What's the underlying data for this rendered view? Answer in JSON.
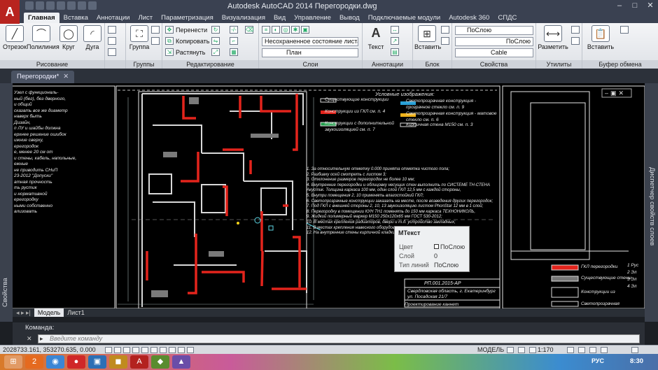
{
  "window": {
    "title": "Autodesk AutoCAD 2014    Перегородки.dwg",
    "logo": "A"
  },
  "ribbon_tabs": [
    "Главная",
    "Вставка",
    "Аннотации",
    "Лист",
    "Параметризация",
    "Визуализация",
    "Вид",
    "Управление",
    "Вывод",
    "Подключаемые модули",
    "Autodesk 360",
    "СПДС"
  ],
  "ribbon": {
    "draw": {
      "title": "Рисование",
      "tools": [
        "Отрезок",
        "Полилиния",
        "Круг",
        "Дуга"
      ]
    },
    "groups": {
      "title": "Группы",
      "tool": "Группа"
    },
    "modify": {
      "title": "Редактирование",
      "move": "Перенести",
      "copy": "Копировать",
      "stretch": "Растянуть"
    },
    "layers": {
      "title": "Слои",
      "state_combo": "Несохраненное состояние листа",
      "layer_combo": "План"
    },
    "annotation": {
      "title": "Аннотации",
      "text": "Текст"
    },
    "block": {
      "title": "Блок",
      "insert": "Вставить"
    },
    "properties": {
      "title": "Свойства",
      "color": "ПоСлою",
      "linetype": "ПоСлою",
      "lineweight": "Cable"
    },
    "utilities": {
      "title": "Утилиты",
      "measure": "Разметить"
    },
    "clipboard": {
      "title": "Буфер обмена",
      "paste": "Вставить"
    }
  },
  "doc_tab": {
    "label": "Перегородки*"
  },
  "palettes": {
    "left": "Свойства",
    "right": "Диспетчер свойств слоев"
  },
  "drawing_text": {
    "legend_title": "Условные изображения:",
    "legend": [
      "Существующие конструкции",
      "Конструкции из ГКЛ см. п. 4",
      "Конструкции с дополнительной звукоизоляцией см. п. 7",
      "Светопрозрачная конструкция - прозрачное стекло см. п. 9",
      "Светопрозрачная конструкция - матовое стекло см. п. 6",
      "Кирпичная стена М150 см. п. 3"
    ],
    "notes": [
      "1. За относительную отметку 0.000 принята отметка чистого пола;",
      "2. Разбивку осей смотреть с листом 3;",
      "3. Отклонение размеров перегородок не более 10 мм;",
      "4. Внутренние перегородки и облицовку несущих стен выполнить по СИСТЕМЕ ТН-СТЕНА Акустик. Толщина каркаса 100 мм, один слой ГКЛ 12,5 мм с каждой стороны,",
      "5. Внутри помещения 2, 10 применять влагостойкий ГКЛ;",
      "6. Светопрозрачные конструкции заказать на месте, после возведения других перегородок;",
      "7. Под ГКЛ с внешней стороны 2, 10, 13 звукоизоляцию листом PhonStar 12 мм в 1 слой;",
      "8. Перегородку в помещении КУН ТН1 поменять до 150 мм каркаса ТЕХНОНИКОЛЬ,",
      "9. Жидкий полимерный маркер М150 250х120х65 мм ГОСТ 530-2012;",
      "10. В местах крепления радиаторов, двери и т.д. устройство закладных;",
      "11. В местах крепления навесного оборудования;",
      "12. На внутренние стены кирпичной кладки..."
    ],
    "stamp_code": "РП.001.2015-АР",
    "stamp_address": "Свердловская область, г. Екатеринбург ул. Посадская 21/7",
    "stamp_footer": "Проектирование каннет",
    "left_fragments": [
      "Узел с функциональ-",
      "ный (бег), без дверного,",
      "и общий",
      "сказать все же диаметр",
      "",
      "наверх быть",
      "",
      "Дизайн,",
      "п ЛУ и шайбы должна",
      "",
      "ерхнее решение ошибок",
      "",
      "ижние сверху,",
      "ерегородок",
      "е, менее 20 см от",
      "и стены, кабель, напольные,",
      "ежные",
      "",
      "не приводить СНиП",
      "23-2012 \"Допуски\"",
      "",
      "атная прочность",
      "ть рустик",
      "и нормативной",
      "ерегородку",
      "ными собственно",
      "ализовать"
    ],
    "right_legend": [
      "ГКЛ перегородки",
      "Существующие стены",
      "Конструкции из",
      "Светопрозрачная"
    ],
    "right_legend_hint": [
      "1 Рус",
      "2 Эл",
      "3 Эл",
      "4 Эл"
    ]
  },
  "tooltip": {
    "title": "МТекст",
    "rows": [
      {
        "key": "Цвет",
        "value": "ПоСлою"
      },
      {
        "key": "Слой",
        "value": "0"
      },
      {
        "key": "Тип линий",
        "value": "ПоСлою"
      }
    ]
  },
  "model_tabs": [
    "Модель",
    "Лист1"
  ],
  "command_line": {
    "history": "Команда:",
    "placeholder": "Введите команду"
  },
  "status_bar": {
    "coords": "2028733.161, 353270.635, 0.000",
    "space": "МОДЕЛЬ",
    "scale": "1:170"
  },
  "taskbar": {
    "language": "РУС",
    "time": "8:30"
  }
}
